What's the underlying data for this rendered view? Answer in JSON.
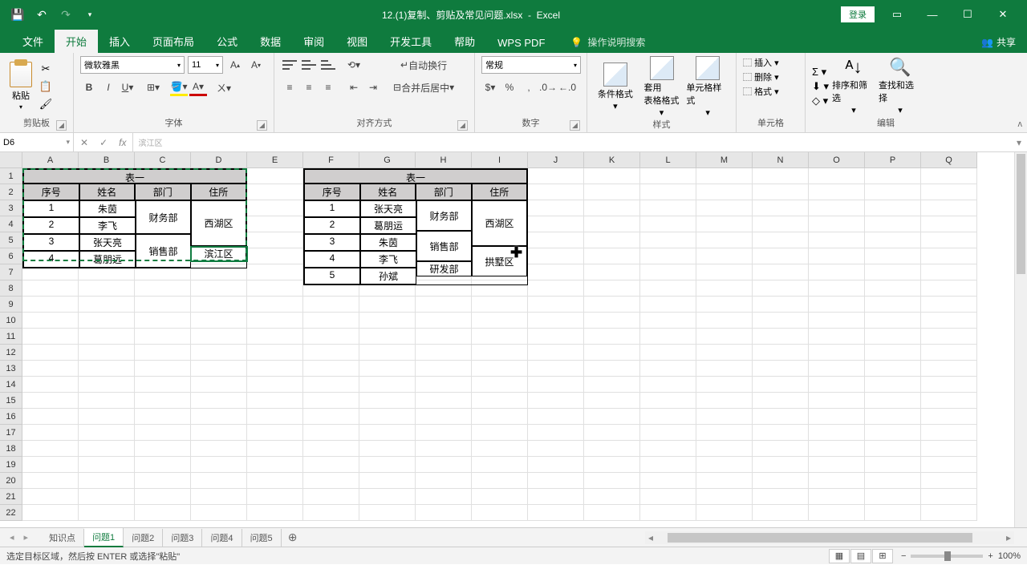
{
  "title": {
    "filename": "12.(1)复制、剪贴及常见问题.xlsx",
    "app": "Excel"
  },
  "login": "登录",
  "tabs": {
    "file": "文件",
    "home": "开始",
    "insert": "插入",
    "page": "页面布局",
    "formula": "公式",
    "data": "数据",
    "review": "审阅",
    "view": "视图",
    "dev": "开发工具",
    "help": "帮助",
    "wps": "WPS PDF",
    "tell": "操作说明搜索",
    "share": "共享"
  },
  "ribbon": {
    "clipboard": {
      "paste": "粘贴",
      "label": "剪贴板"
    },
    "font": {
      "family": "微软雅黑",
      "size": "11",
      "label": "字体"
    },
    "align": {
      "wrap": "自动换行",
      "merge": "合并后居中",
      "label": "对齐方式"
    },
    "number": {
      "format": "常规",
      "label": "数字"
    },
    "styles": {
      "cond": "条件格式",
      "table": "套用\n表格格式",
      "cell": "单元格样式",
      "label": "样式"
    },
    "cells": {
      "insert": "插入",
      "delete": "删除",
      "format": "格式",
      "label": "单元格"
    },
    "editing": {
      "sort": "排序和筛选",
      "find": "查找和选择",
      "label": "编辑"
    }
  },
  "namebox": "D6",
  "fx_val": "滨江区",
  "cols": [
    "A",
    "B",
    "C",
    "D",
    "E",
    "F",
    "G",
    "H",
    "I",
    "J",
    "K",
    "L",
    "M",
    "N",
    "O",
    "P",
    "Q"
  ],
  "rows": [
    "1",
    "2",
    "3",
    "4",
    "5",
    "6",
    "7",
    "8",
    "9",
    "10",
    "11",
    "12",
    "13",
    "14",
    "15",
    "16",
    "17",
    "18",
    "19",
    "20",
    "21",
    "22"
  ],
  "table1": {
    "title": "表一",
    "h": [
      "序号",
      "姓名",
      "部门",
      "住所"
    ],
    "r": [
      [
        "1",
        "朱茵"
      ],
      [
        "2",
        "李飞"
      ],
      [
        "3",
        "张天亮"
      ],
      [
        "4",
        "葛朋远"
      ]
    ],
    "dept": [
      "财务部",
      "销售部"
    ],
    "addr": [
      "西湖区",
      "滨江区"
    ]
  },
  "table2": {
    "title": "表一",
    "h": [
      "序号",
      "姓名",
      "部门",
      "住所"
    ],
    "r": [
      [
        "1",
        "张天亮"
      ],
      [
        "2",
        "葛朋运"
      ],
      [
        "3",
        "朱茵"
      ],
      [
        "4",
        "李飞"
      ],
      [
        "5",
        "孙斌"
      ]
    ],
    "dept": [
      "财务部",
      "销售部",
      "研发部"
    ],
    "addr": [
      "西湖区",
      "拱墅区"
    ]
  },
  "sheets": {
    "kb": "知识点",
    "q1": "问题1",
    "q2": "问题2",
    "q3": "问题3",
    "q4": "问题4",
    "q5": "问题5"
  },
  "status": "选定目标区域，然后按 ENTER 或选择\"粘贴\"",
  "zoom": "100%"
}
